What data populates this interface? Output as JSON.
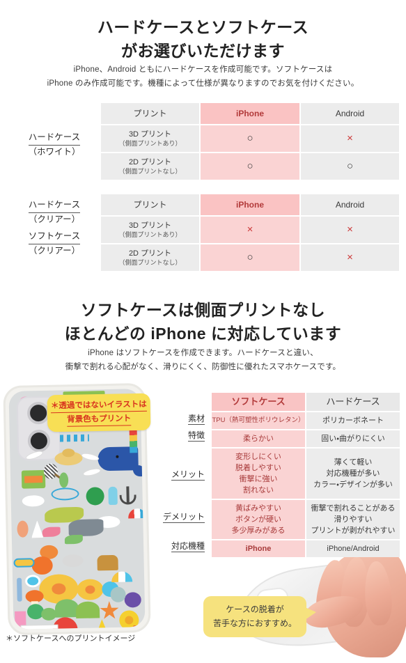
{
  "section1": {
    "heading_line1": "ハードケースとソフトケース",
    "heading_line2": "がお選びいただけます",
    "lead_line1": "iPhone、Android ともにハードケースを作成可能です。ソフトケースは",
    "lead_line2": "iPhone のみ作成可能です。機種によって仕様が異なりますのでお気を付けください。"
  },
  "table_white": {
    "row_label_line1": "ハードケース",
    "row_label_line2": "（ホワイト）",
    "headers": [
      "プリント",
      "iPhone",
      "Android"
    ],
    "rows": [
      {
        "print_main": "3D プリント",
        "print_sub": "（側面プリントあり）",
        "iphone": "○",
        "android": "×"
      },
      {
        "print_main": "2D プリント",
        "print_sub": "（側面プリントなし）",
        "iphone": "○",
        "android": "○"
      }
    ]
  },
  "table_clear": {
    "row_label_line1": "ハードケース",
    "row_label_line2": "（クリアー）",
    "row_label_line3": "ソフトケース",
    "row_label_line4": "（クリアー）",
    "headers": [
      "プリント",
      "iPhone",
      "Android"
    ],
    "rows": [
      {
        "print_main": "3D プリント",
        "print_sub": "（側面プリントあり）",
        "iphone": "×",
        "android": "×"
      },
      {
        "print_main": "2D プリント",
        "print_sub": "（側面プリントなし）",
        "iphone": "○",
        "android": "×"
      }
    ]
  },
  "section2": {
    "heading_line1": "ソフトケースは側面プリントなし",
    "heading_line2": "ほとんどの iPhone に対応しています",
    "lead_line1": "iPhone はソフトケースを作成できます。ハードケースと違い、",
    "lead_line2": "衝撃で割れる心配がなく、滑りにくく、防御性に優れたスマホケースです。"
  },
  "spec_table": {
    "headers": [
      "ソフトケース",
      "ハードケース"
    ],
    "labels": [
      "素材",
      "特徴",
      "メリット",
      "デメリット",
      "対応機種"
    ],
    "rows": [
      {
        "label": "素材",
        "soft": "TPU（熱可塑性ポリウレタン）",
        "hard": "ポリカーボネート"
      },
      {
        "label": "特徴",
        "soft": "柔らかい",
        "hard": "固い・曲がりにくい"
      },
      {
        "label": "メリット",
        "soft_lines": [
          "変形しにくい",
          "脱着しやすい",
          "衝撃に強い",
          "割れない"
        ],
        "hard_lines": [
          "薄くて軽い",
          "対応機種が多い",
          "カラー・デザインが多い"
        ]
      },
      {
        "label": "デメリット",
        "soft_lines": [
          "黄ばみやすい",
          "ボタンが硬い",
          "多少厚みがある"
        ],
        "hard_lines": [
          "衝撃で割れることがある",
          "滑りやすい",
          "プリントが剥がれやすい"
        ]
      },
      {
        "label": "対応機種",
        "soft": "iPhone",
        "hard": "iPhone/Android"
      }
    ]
  },
  "callouts": {
    "print_note_line1": "＊透過ではないイラストは",
    "print_note_line2": "背景色もプリント",
    "bubble_line1": "ケースの脱着が",
    "bubble_line2": "苦手な方におすすめ。"
  },
  "footnote": "＊ソフトケースへのプリントイメージ",
  "colors": {
    "pink_header": "#fac3c3",
    "pink_cell": "#fad3d3",
    "gray_cell": "#ececec",
    "accent_red": "#b23a3a",
    "mark_x": "#cc3a3a",
    "callout_yellow": "#f8df55",
    "bubble_yellow": "#f6e27e"
  }
}
